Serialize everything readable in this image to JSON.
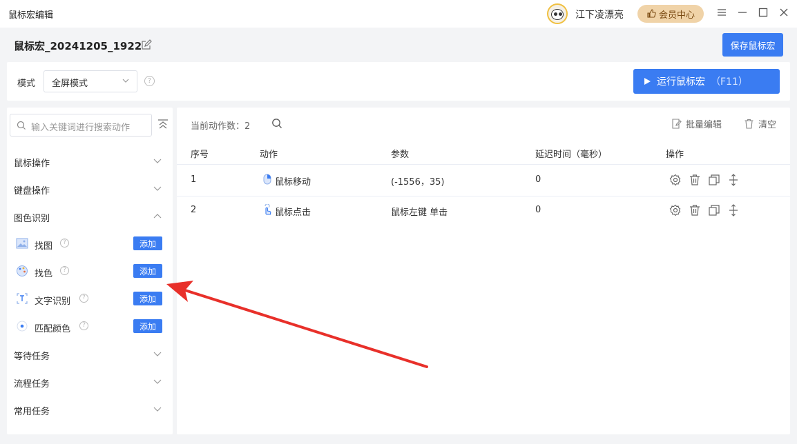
{
  "window": {
    "title": "鼠标宏编辑",
    "username": "江下凌漂亮",
    "vip_label": "会员中心"
  },
  "macro": {
    "name": "鼠标宏_20241205_1922",
    "save_label": "保存鼠标宏"
  },
  "mode": {
    "label": "模式",
    "value": "全屏模式",
    "run_label": "运行鼠标宏",
    "run_shortcut": "（F11）"
  },
  "sidebar": {
    "search_placeholder": "输入关键词进行搜索动作",
    "categories": [
      {
        "label": "鼠标操作",
        "expanded": false
      },
      {
        "label": "键盘操作",
        "expanded": false
      },
      {
        "label": "图色识别",
        "expanded": true
      },
      {
        "label": "等待任务",
        "expanded": false
      },
      {
        "label": "流程任务",
        "expanded": false
      },
      {
        "label": "常用任务",
        "expanded": false
      }
    ],
    "items": [
      {
        "label": "找图",
        "icon": "image-icon",
        "add_label": "添加"
      },
      {
        "label": "找色",
        "icon": "palette-icon",
        "add_label": "添加"
      },
      {
        "label": "文字识别",
        "icon": "text-recognition-icon",
        "add_label": "添加"
      },
      {
        "label": "匹配颜色",
        "icon": "color-match-icon",
        "add_label": "添加"
      }
    ]
  },
  "main": {
    "count_label": "当前动作数：2",
    "batch_edit_label": "批量编辑",
    "clear_label": "清空",
    "columns": [
      "序号",
      "动作",
      "参数",
      "延迟时间（毫秒）",
      "操作"
    ],
    "rows": [
      {
        "index": "1",
        "action": "鼠标移动",
        "action_icon": "mouse-move-icon",
        "params": "(-1556，35)",
        "delay": "0"
      },
      {
        "index": "2",
        "action": "鼠标点击",
        "action_icon": "mouse-click-icon",
        "params": "鼠标左键 单击",
        "delay": "0"
      }
    ]
  },
  "colors": {
    "primary": "#3a7cf2",
    "vip": "#f0d3a8",
    "annotation_arrow": "#e8302a"
  }
}
